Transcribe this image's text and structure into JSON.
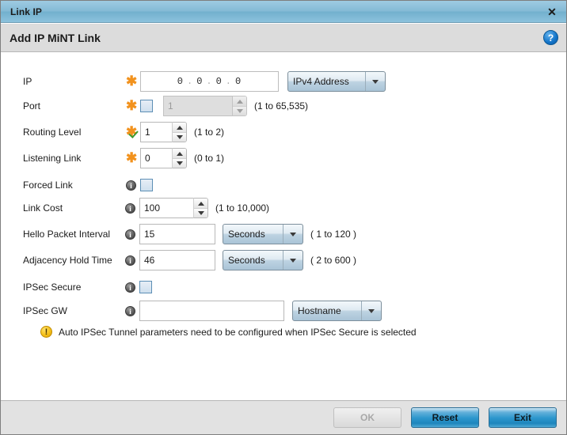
{
  "window": {
    "title": "Link IP",
    "close_label": "✕"
  },
  "header": {
    "title": "Add IP MiNT Link",
    "help_label": "?"
  },
  "form": {
    "ip": {
      "label": "IP",
      "octet1": "0",
      "octet2": "0",
      "octet3": "0",
      "octet4": "0",
      "separator": ".",
      "type_value": "IPv4 Address"
    },
    "port": {
      "label": "Port",
      "value": "1",
      "hint": "(1 to 65,535)",
      "checkbox_checked": "false",
      "enabled": "false"
    },
    "routing_level": {
      "label": "Routing Level",
      "value": "1",
      "hint": "(1 to 2)"
    },
    "listening_link": {
      "label": "Listening Link",
      "value": "0",
      "hint": "(0 to 1)"
    },
    "forced_link": {
      "label": "Forced Link",
      "checkbox_checked": "false"
    },
    "link_cost": {
      "label": "Link Cost",
      "value": "100",
      "hint": "(1 to 10,000)"
    },
    "hello_packet_interval": {
      "label": "Hello Packet Interval",
      "value": "15",
      "unit": "Seconds",
      "hint": "( 1 to 120 )"
    },
    "adjacency_hold_time": {
      "label": "Adjacency Hold Time",
      "value": "46",
      "unit": "Seconds",
      "hint": "( 2 to 600 )"
    },
    "ipsec_secure": {
      "label": "IPSec Secure",
      "checkbox_checked": "false"
    },
    "ipsec_gw": {
      "label": "IPSec GW",
      "value": "",
      "placeholder": "",
      "type_value": "Hostname"
    },
    "warning": {
      "icon_label": "!",
      "text": "Auto IPSec Tunnel parameters need to be configured when IPSec Secure is selected"
    },
    "asterisk_glyph": "✱",
    "info_glyph": "i"
  },
  "footer": {
    "ok_label": "OK",
    "reset_label": "Reset",
    "exit_label": "Exit"
  },
  "colors": {
    "titlebar": "#84bad6",
    "accent": "#2d97cd",
    "required": "#f2921d",
    "warning": "#f5c019",
    "valid": "#3f9a2e"
  }
}
